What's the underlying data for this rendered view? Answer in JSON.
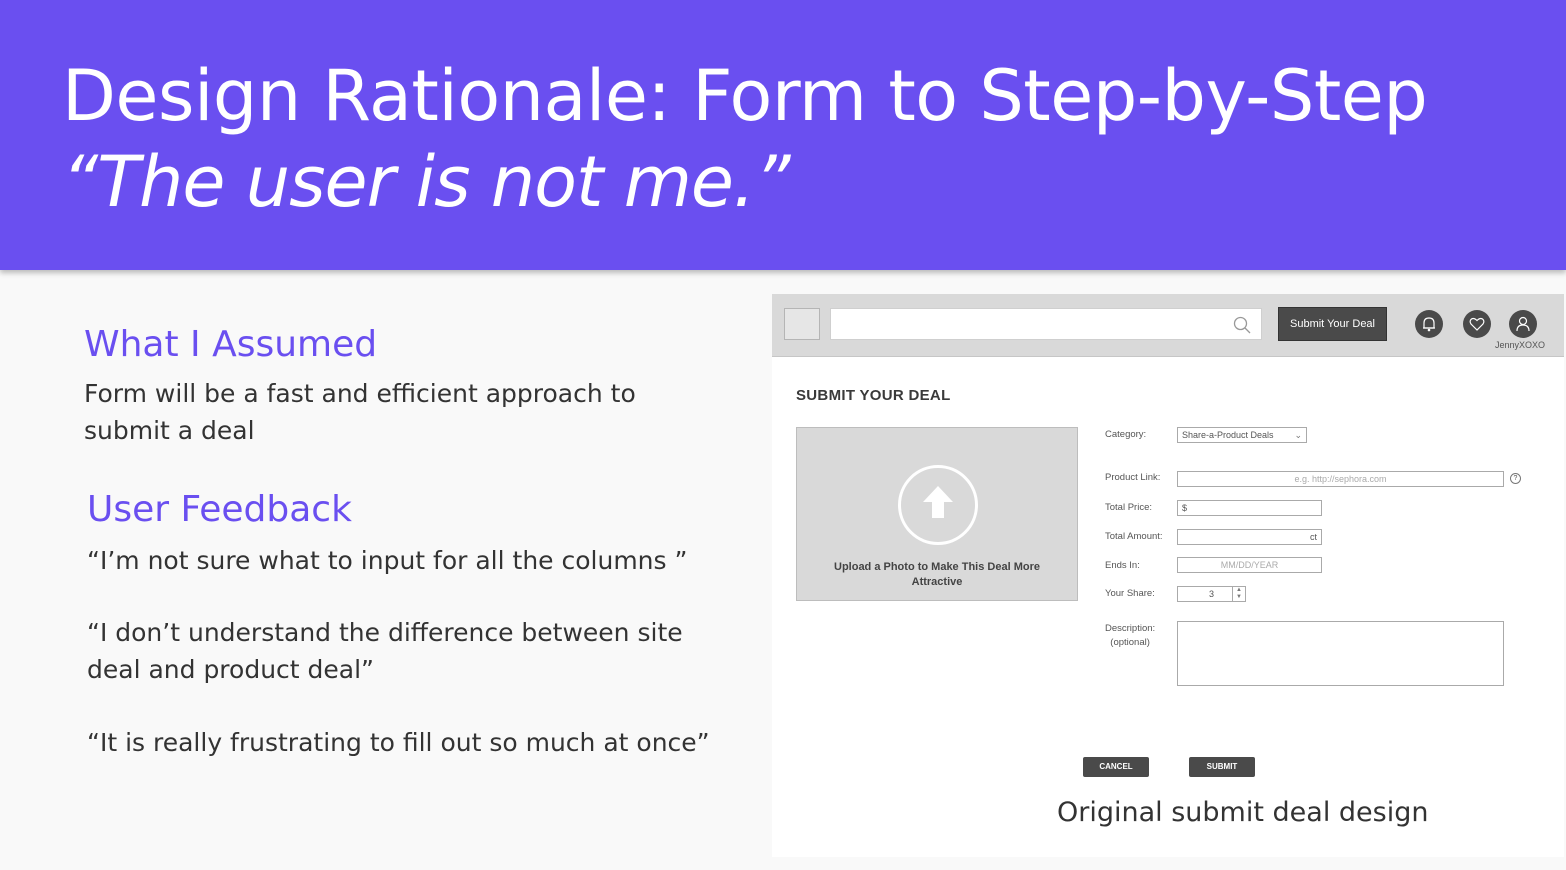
{
  "slide": {
    "title_line1": "Design Rationale: Form to Step-by-Step",
    "title_line2": "“The user is not me.”",
    "assumed_heading": "What I Assumed",
    "assumed_text": "Form will be a fast and efficient approach to submit a deal",
    "feedback_heading": "User Feedback",
    "feedback": [
      "“I’m not sure what to input for all the columns ”",
      "“I don’t understand the difference between site deal and product deal”",
      "“It is really frustrating to fill out so much at once”"
    ],
    "caption": "Original submit deal design"
  },
  "mockup": {
    "nav": {
      "search_placeholder": "",
      "submit_button": "Submit Your Deal",
      "username": "JennyXOXO"
    },
    "form_title": "SUBMIT YOUR DEAL",
    "upload_caption": "Upload a Photo to Make This Deal More Attractive",
    "fields": {
      "category_label": "Category:",
      "category_value": "Share-a-Product Deals",
      "product_link_label": "Product Link:",
      "product_link_placeholder": "e.g. http://sephora.com",
      "total_price_label": "Total Price:",
      "total_price_prefix": "$",
      "total_amount_label": "Total Amount:",
      "total_amount_suffix": "ct",
      "ends_in_label": "Ends In:",
      "ends_in_placeholder": "MM/DD/YEAR",
      "your_share_label": "Your Share:",
      "your_share_value": "3",
      "description_label": "Description:",
      "description_optional": "(optional)"
    },
    "buttons": {
      "cancel": "CANCEL",
      "submit": "SUBMIT"
    }
  },
  "colors": {
    "accent": "#6a4ff0",
    "button_dark": "#4a4a4a"
  }
}
